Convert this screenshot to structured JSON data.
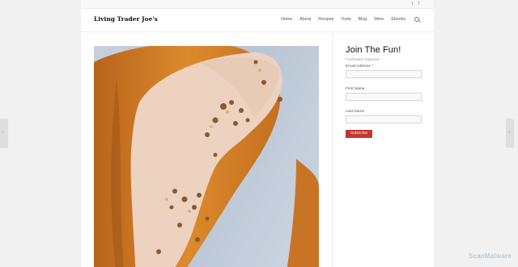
{
  "site": {
    "logo": "Living Trader Joe's"
  },
  "social": {
    "twitter": "t",
    "facebook": "f"
  },
  "nav": {
    "items": [
      {
        "label": "Home"
      },
      {
        "label": "About"
      },
      {
        "label": "Recipes"
      },
      {
        "label": "Tools"
      },
      {
        "label": "Blog"
      },
      {
        "label": "Wine"
      },
      {
        "label": "Ebooks"
      }
    ],
    "search_icon": "search-icon"
  },
  "side_tabs": {
    "prev_icon": "‹",
    "next_icon": "›"
  },
  "hero": {
    "image": "glazed pastry with pecans"
  },
  "signup": {
    "title": "Join The Fun!",
    "required_star": "*",
    "required_note": "indicates required",
    "email_label": "Email Address",
    "first_label": "First Name",
    "last_label": "Last Name",
    "email_value": "",
    "first_value": "",
    "last_value": "",
    "submit_label": "Subscribe"
  },
  "watermark": "ScanMalware",
  "colors": {
    "accent": "#c1392e",
    "background": "#f1f1f1"
  }
}
